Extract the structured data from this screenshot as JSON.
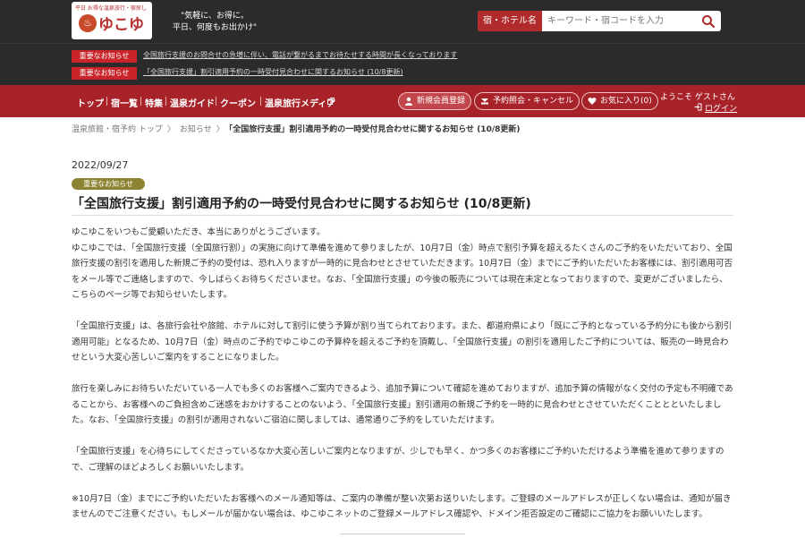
{
  "header": {
    "logo_sub": "平日 お得な温泉旅行・宿探し",
    "logo_text": "ゆこゆこ",
    "tagline_1": "\"気軽に、お得に。",
    "tagline_2": "平日、何度もお出かけ\"",
    "search_category": "宿・ホテル名",
    "search_placeholder": "キーワード・宿コードを入力"
  },
  "notices": [
    {
      "badge": "重要なお知らせ",
      "text": "全国旅行支援のお問合せの急増に伴い、電話が繋がるまでお待たせする時間が長くなっております"
    },
    {
      "badge": "重要なお知らせ",
      "text": "「全国旅行支援」割引適用予約の一時受付見合わせに関するお知らせ (10/8更新)"
    }
  ],
  "nav": {
    "links": [
      "トップ",
      "宿一覧",
      "特集",
      "温泉ガイド",
      "クーポン",
      "温泉旅行メディア"
    ],
    "register": "新規会員登録",
    "reservation": "予約照会・キャンセル",
    "favorites": "お気に入り(0)",
    "welcome": "ようこそ ゲストさん",
    "login": "ログイン"
  },
  "breadcrumb": {
    "items": [
      "温泉旅館・宿予約 トップ",
      "お知らせ"
    ],
    "current": "「全国旅行支援」割引適用予約の一時受付見合わせに関するお知らせ (10/8更新)",
    "sep": "〉"
  },
  "article": {
    "date": "2022/09/27",
    "tag": "重要なお知らせ",
    "title": "「全国旅行支援」割引適用予約の一時受付見合わせに関するお知らせ (10/8更新)",
    "paragraphs": [
      "ゆこゆこをいつもご愛顧いただき、本当にありがとうございます。\nゆこゆこでは、「全国旅行支援（全国旅行割）」の実施に向けて準備を進めて参りましたが、10月7日（金）時点で割引予算を超えるたくさんのご予約をいただいており、全国旅行支援の割引を適用した新規ご予約の受付は、恐れ入りますが一時的に見合わせとさせていただきます。10月7日（金）までにご予約いただいたお客様には、割引適用可否をメール等でご連絡しますので、今しばらくお待ちくださいませ。なお、「全国旅行支援」の今後の販売については現在未定となっておりますので、変更がございましたら、こちらのページ等でお知らせいたします。",
      "「全国旅行支援」は、各旅行会社や旅館、ホテルに対して割引に使う予算が割り当てられております。また、都道府県により「既にご予約となっている予約分にも後から割引適用可能」となるため、10月7日（金）時点のご予約でゆこゆこの予算枠を超えるご予約を頂戴し、「全国旅行支援」の割引を適用したご予約については、販売の一時見合わせという大変心苦しいご案内をすることになりました。",
      "旅行を楽しみにお待ちいただいている一人でも多くのお客様へご案内できるよう、追加予算について確認を進めておりますが、追加予算の情報がなく交付の予定も不明確であることから、お客様へのご負担含めご迷惑をおかけすることのないよう、「全国旅行支援」割引適用の新規ご予約を一時的に見合わせとさせていただくこととといたしました。なお、「全国旅行支援」の割引が適用されないご宿泊に関しましては、通常通りご予約をしていただけます。",
      "「全国旅行支援」を心待ちにしてくださっているなか大変心苦しいご案内となりますが、少しでも早く、かつ多くのお客様にご予約いただけるよう準備を進めて参りますので、ご理解のほどよろしくお願いいたします。",
      "※10月7日（金）までにご予約いただいたお客様へのメール通知等は、ご案内の準備が整い次第お送りいたします。ご登録のメールアドレスが正しくない場合は、通知が届きませんのでご注意ください。もしメールが届かない場合は、ゆこゆこネットのご登録メールアドレス確認や、ドメイン拒否設定のご確認にご協力をお願いいたします。"
    ]
  }
}
